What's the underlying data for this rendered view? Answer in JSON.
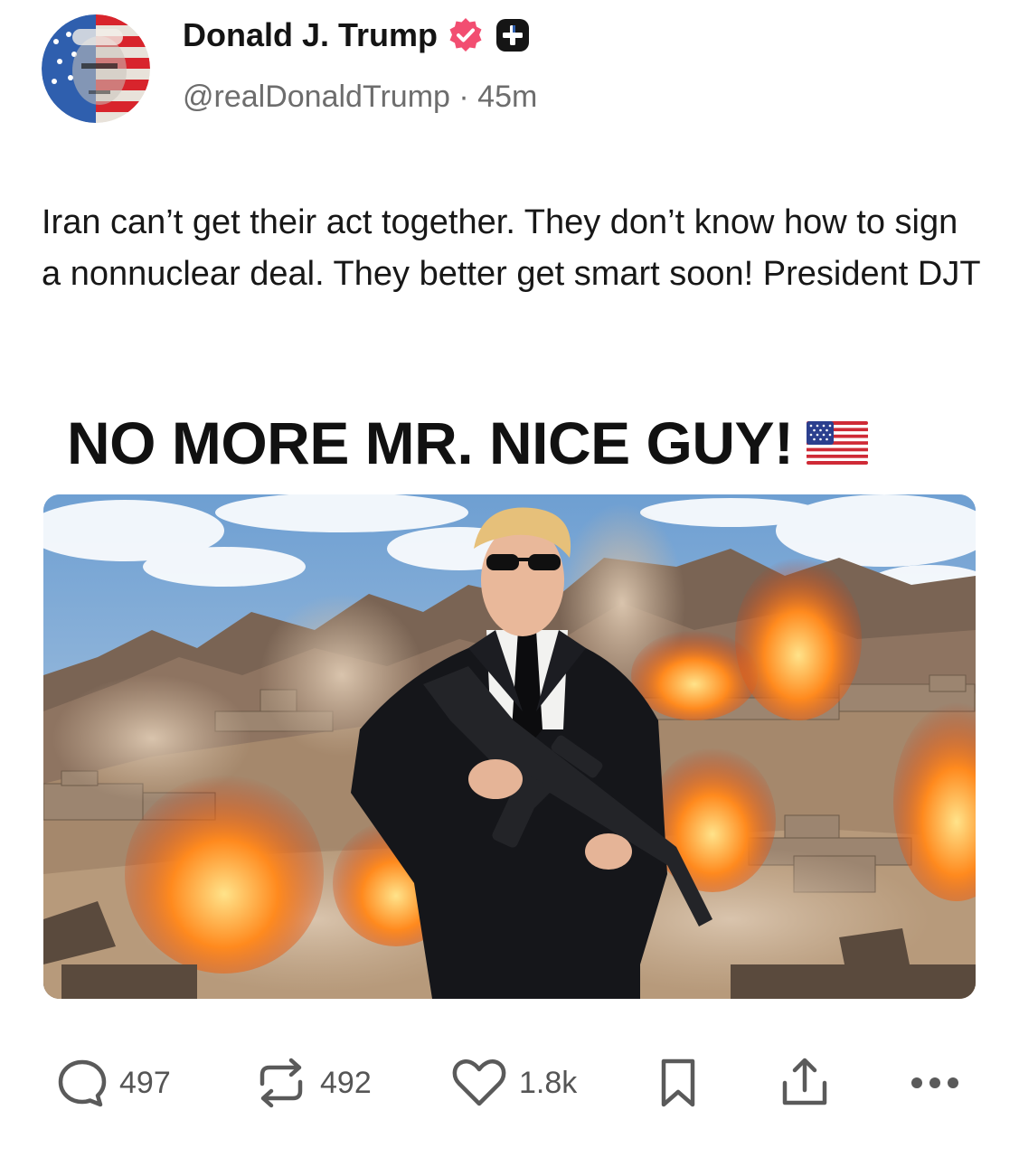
{
  "post": {
    "author": {
      "display_name": "Donald J. Trump",
      "handle": "@realDonaldTrump",
      "separator": "·",
      "time_ago": "45m",
      "verified_badge": "verified-icon",
      "plus_badge": "plus-badge-icon"
    },
    "text": "Iran can’t get their act together. They don’t know how to sign a nonnuclear deal. They better get smart soon! President DJT",
    "media": {
      "headline": "NO MORE MR. NICE GUY!",
      "headline_emoji": "us-flag-icon",
      "image_subject": "man in black suit holding rifle before explosions in desert town"
    },
    "actions": {
      "replies": "497",
      "reposts": "492",
      "likes": "1.8k",
      "bookmark": "bookmark-icon",
      "share": "share-icon",
      "more": "more-icon"
    }
  },
  "colors": {
    "verified": "#f24e71",
    "text": "#171717",
    "muted": "#6d6d6d",
    "icon": "#555555"
  }
}
